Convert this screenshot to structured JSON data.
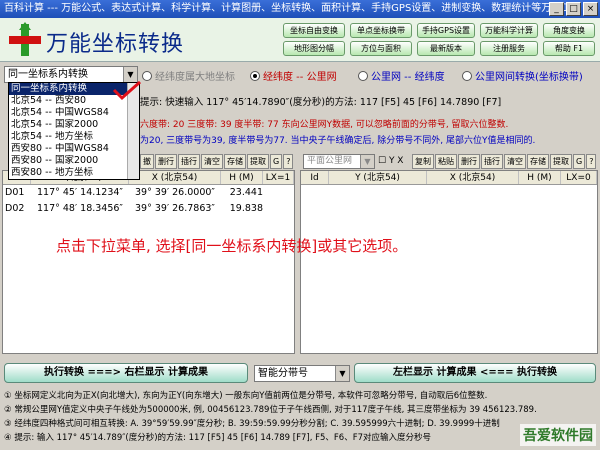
{
  "window": {
    "title": "百科计算 --- 万能公式、表达式计算、科学计算、计算图册、坐标转换、面积计算、手持GPS设置、进制变换、数理统计等万用工具"
  },
  "app_title": "万能坐标转换",
  "toolbar": [
    "坐标自由变换",
    "单点坐标换带",
    "手持GPS设置",
    "万能科学计算",
    "角度变换",
    "地形图分幅",
    "方位与面积",
    "最新版本",
    "注册服务",
    "帮助 F1"
  ],
  "mode_select": {
    "value": "同一坐标系内转换"
  },
  "dropdown_options": [
    "同一坐标系内转换",
    "北京54 -- 西安80",
    "北京54 -- 中国WGS84",
    "北京54 -- 国家2000",
    "北京54 -- 地方坐标",
    "西安80 -- 中国WGS84",
    "西安80 -- 国家2000",
    "西安80 -- 地方坐标"
  ],
  "radios": {
    "hint": "经纬度属大地坐标",
    "opt1": "经纬度 -- 公里网",
    "opt2": "公里网 -- 经纬度",
    "opt3": "公里网间转换(坐标换带)"
  },
  "tip_line": "提示: 快速输入 117° 45′14.7890″(度分秒)的方法: 117 [F5]   45 [F6]   14.7890 [F7]",
  "info": {
    "line1": "六度带: 20  三度带: 39  度半带: 77      东向公里网Y数据, 可以忽略前面的分带号, 留取六位整数.",
    "line2": "为20, 三度带号为39, 度半带号为77.  当中央子午线确定后, 除分带号不同外, 尾部六位Y值是相同的."
  },
  "left_toolbar": [
    "撤",
    "删行",
    "插行",
    "清空",
    "存储",
    "提取",
    "G",
    "?"
  ],
  "right_toolbar": [
    "复制",
    "粘贴",
    "删行",
    "插行",
    "清空",
    "存储",
    "提取",
    "G",
    "?"
  ],
  "right_select": "平面公里网",
  "right_checks": "Y  X",
  "left_grid": {
    "headers": [
      "Id",
      "Y (北京54)",
      "X (北京54)",
      "H (M)",
      "LX=1"
    ],
    "rows": [
      [
        "D01",
        "117° 45′ 14.1234″",
        "39° 39′ 26.0000″",
        "23.441",
        ""
      ],
      [
        "D02",
        "117° 48′ 18.3456″",
        "39° 39′ 26.7863″",
        "19.838",
        ""
      ]
    ]
  },
  "right_grid": {
    "headers": [
      "Id",
      "Y (北京54)",
      "X (北京54)",
      "H (M)",
      "LX=0"
    ]
  },
  "overlay_instruction": "点击下拉菜单, 选择[同一坐标系内转换]或其它选项。",
  "actions": {
    "left_exec": "执行转换 ===> 右栏显示 计算成果",
    "zone_select": "智能分带号",
    "right_exec": "左栏显示 计算成果 <=== 执行转换"
  },
  "notes": [
    "① 坐标网定义北向为正X(向北增大), 东向为正Y(向东增大)  一般东向Y值前两位是分带号, 本软件可忽略分带号, 自动取后6位整数.",
    "② 常规公里网Y值定义中央子午线处为500000米, 例, 00456123.789位于子午线西侧, 对于117度子午线, 其三度带坐标为 39 456123.789.",
    "③ 经纬度四种格式间可相互转换: A. 39°59′59.99″度分秒; B. 39:59:59.99分秒分割; C. 39.595999六十进制; D. 39.9999十进制",
    "④ 提示: 输入 117° 45′14.789″(度分秒)的方法: 117 [F5]   45 [F6]   14.789 [F7], F5、F6、F7对应输入度分秒号"
  ],
  "watermark": "吾爱软件园"
}
